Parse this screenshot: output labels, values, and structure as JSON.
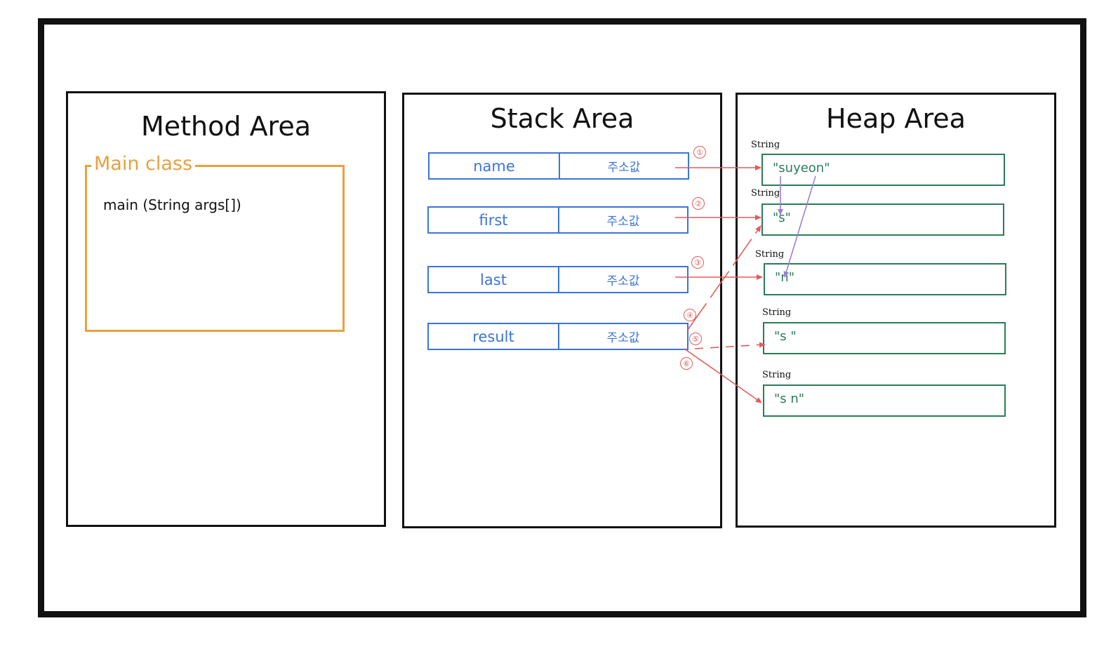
{
  "method_area": {
    "title": "Method Area",
    "class_label": "Main class",
    "method_signature": "main (String args[])"
  },
  "stack_area": {
    "title": "Stack Area",
    "variables": [
      {
        "name": "name",
        "value": "주소값"
      },
      {
        "name": "first",
        "value": "주소값"
      },
      {
        "name": "last",
        "value": "주소값"
      },
      {
        "name": "result",
        "value": "주소값"
      }
    ]
  },
  "heap_area": {
    "title": "Heap Area",
    "objects": [
      {
        "type": "String",
        "value": "\"suyeon\""
      },
      {
        "type": "String",
        "value": "\"s\""
      },
      {
        "type": "String",
        "value": "\"n\""
      },
      {
        "type": "String",
        "value": "\"s  \""
      },
      {
        "type": "String",
        "value": "\"s   n\""
      }
    ]
  },
  "markers": [
    "①",
    "②",
    "③",
    "④",
    "⑤",
    "⑥"
  ],
  "colors": {
    "frame": "#111111",
    "method_class": "#e8a13d",
    "stack_var": "#3b74d9",
    "heap_obj": "#2a7d55",
    "reference_arrow": "#e35b5b",
    "substring_arrow": "#9b7fd4"
  }
}
